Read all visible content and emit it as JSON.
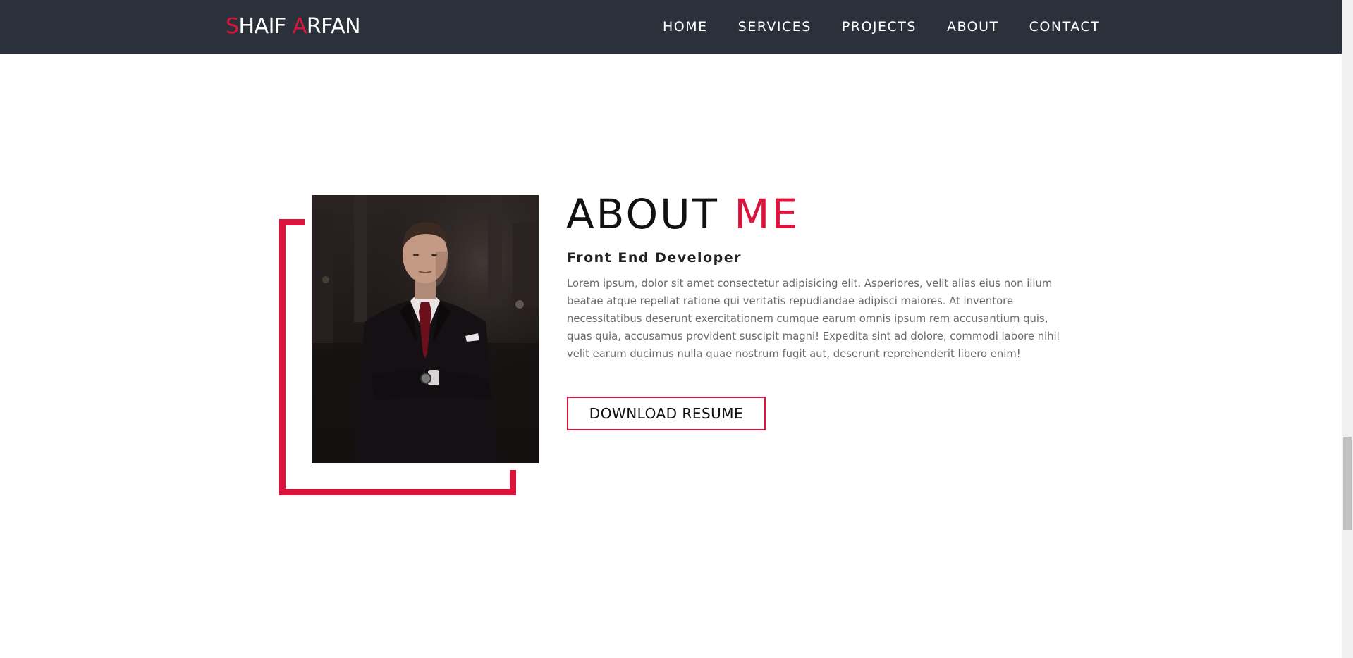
{
  "navbar": {
    "logo": {
      "first_initial": "S",
      "first_rest": "HAIF ",
      "last_initial": "A",
      "last_rest": "RFAN"
    },
    "links": [
      {
        "label": "HOME"
      },
      {
        "label": "SERVICES"
      },
      {
        "label": "PROJECTS"
      },
      {
        "label": "ABOUT"
      },
      {
        "label": "CONTACT"
      }
    ]
  },
  "about": {
    "title_main": "ABOUT ",
    "title_accent": "ME",
    "subtitle": "Front End Developer",
    "body": "Lorem ipsum, dolor sit amet consectetur adipisicing elit. Asperiores, velit alias eius non illum beatae atque repellat ratione qui veritatis repudiandae adipisci maiores. At inventore necessitatibus deserunt exercitationem cumque earum omnis ipsum rem accusantium quis, quas quia, accusamus provident suscipit magni! Expedita sint ad dolore, commodi labore nihil velit earum ducimus nulla quae nostrum fugit aut, deserunt reprehenderit libero enim!",
    "button_label": "DOWNLOAD RESUME"
  },
  "colors": {
    "accent": "#dc143c",
    "navbar_bg": "#2b313b",
    "text_dark": "#111111",
    "text_muted": "#6a6a6a"
  }
}
